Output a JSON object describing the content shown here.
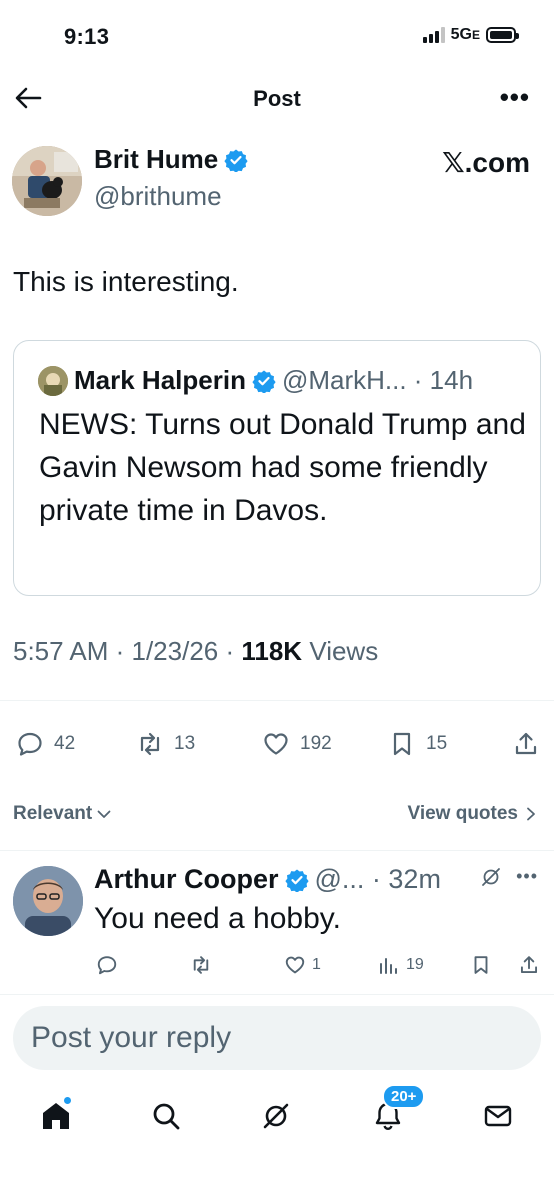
{
  "status_bar": {
    "time": "9:13",
    "network": "5G",
    "network_suffix": "E"
  },
  "header": {
    "title": "Post",
    "more": "•••"
  },
  "post": {
    "author_name": "Brit Hume",
    "author_handle": "@brithume",
    "source_logo": "𝕏.com",
    "text": "This is interesting.",
    "timestamp": "5:57 AM · 1/23/26 · ",
    "views_count": "118K",
    "views_label": " Views",
    "stats": {
      "replies": "42",
      "reposts": "13",
      "likes": "192",
      "bookmarks": "15"
    }
  },
  "quote": {
    "author_name": "Mark Halperin",
    "meta": "@MarkH... · 14h",
    "text": "NEWS: Turns out Donald Trump and Gavin Newsom had some friendly private time in Davos."
  },
  "reply_controls": {
    "sort_label": "Relevant",
    "view_quotes_label": "View quotes"
  },
  "reply": {
    "author_name": "Arthur Cooper",
    "meta": "@... · 32m",
    "text": "You need a hobby.",
    "likes": "1",
    "views": "19"
  },
  "composer": {
    "placeholder": "Post your reply"
  },
  "tabbar": {
    "notifications_badge": "20+"
  },
  "colors": {
    "accent": "#1d9bf0",
    "text": "#0f1419",
    "secondary": "#536471",
    "border": "#cfd9de"
  },
  "icons": [
    "back-arrow-icon",
    "more-icon",
    "verified-icon",
    "reply-icon",
    "repost-icon",
    "like-icon",
    "bookmark-icon",
    "share-icon",
    "grok-icon",
    "views-icon",
    "home-icon",
    "search-icon",
    "notifications-icon",
    "messages-icon"
  ]
}
